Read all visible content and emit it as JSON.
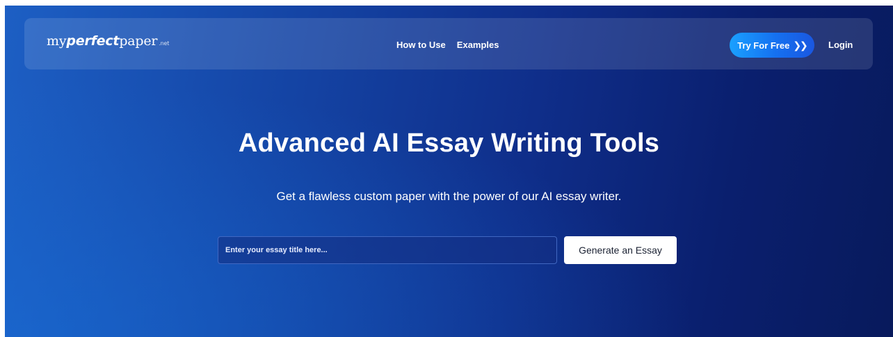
{
  "navbar": {
    "logo": {
      "part_light": "my",
      "part_bold": "perfect",
      "part_end": "paper",
      "tld": ".net"
    },
    "links": [
      "How to Use",
      "Examples"
    ],
    "try_button": {
      "label": "Try For Free",
      "icon": "double-chevron-right-icon"
    },
    "login_label": "Login"
  },
  "hero": {
    "title": "Advanced AI Essay Writing Tools",
    "subtitle": "Get a flawless custom paper with the power of our AI essay writer.",
    "input": {
      "value": "",
      "placeholder": "Enter your essay title here..."
    },
    "cta_label": "Generate an Essay"
  },
  "colors": {
    "background_start": "#1d5fc4",
    "background_end": "#081a5c",
    "try_button_accent": "#1aa0ff",
    "cta_background": "#ffffff"
  }
}
